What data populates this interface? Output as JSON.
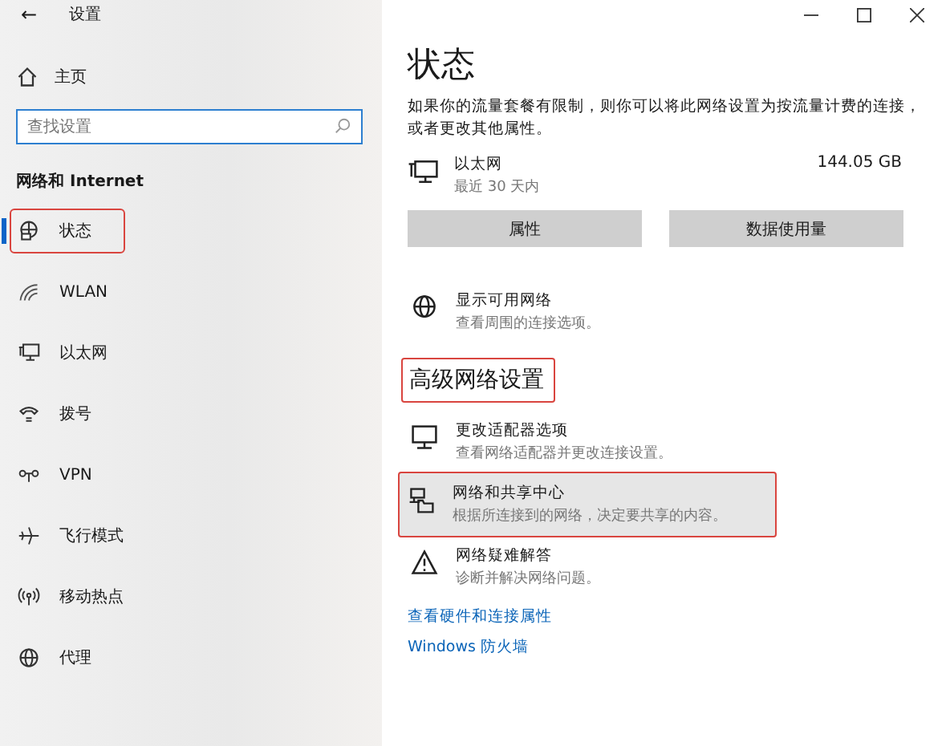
{
  "window": {
    "title": "设置",
    "back": "←"
  },
  "sidebar": {
    "home": "主页",
    "search": {
      "placeholder": "查找设置"
    },
    "section": "网络和 Internet",
    "items": [
      {
        "label": "状态",
        "selected": true,
        "annotated": true
      },
      {
        "label": "WLAN",
        "selected": false,
        "annotated": false
      },
      {
        "label": "以太网",
        "selected": false,
        "annotated": false
      },
      {
        "label": "拨号",
        "selected": false,
        "annotated": false
      },
      {
        "label": "VPN",
        "selected": false,
        "annotated": false
      },
      {
        "label": "飞行模式",
        "selected": false,
        "annotated": false
      },
      {
        "label": "移动热点",
        "selected": false,
        "annotated": false
      },
      {
        "label": "代理",
        "selected": false,
        "annotated": false
      }
    ]
  },
  "main": {
    "title": "状态",
    "description": "如果你的流量套餐有限制，则你可以将此网络设置为按流量计费的连接，或者更改其他属性。",
    "connection": {
      "name": "以太网",
      "period": "最近 30 天内",
      "usage": "144.05 GB"
    },
    "buttons": [
      "属性",
      "数据使用量"
    ],
    "show_networks": {
      "title": "显示可用网络",
      "subtitle": "查看周围的连接选项。"
    },
    "advanced": {
      "heading": "高级网络设置",
      "annotated": true,
      "options": [
        {
          "title": "更改适配器选项",
          "subtitle": "查看网络适配器并更改连接设置。",
          "hovered": false,
          "annotated": false
        },
        {
          "title": "网络和共享中心",
          "subtitle": "根据所连接到的网络，决定要共享的内容。",
          "hovered": true,
          "annotated": true
        },
        {
          "title": "网络疑难解答",
          "subtitle": "诊断并解决网络问题。",
          "hovered": false,
          "annotated": false
        }
      ]
    },
    "links": [
      "查看硬件和连接属性",
      "Windows 防火墙"
    ]
  }
}
